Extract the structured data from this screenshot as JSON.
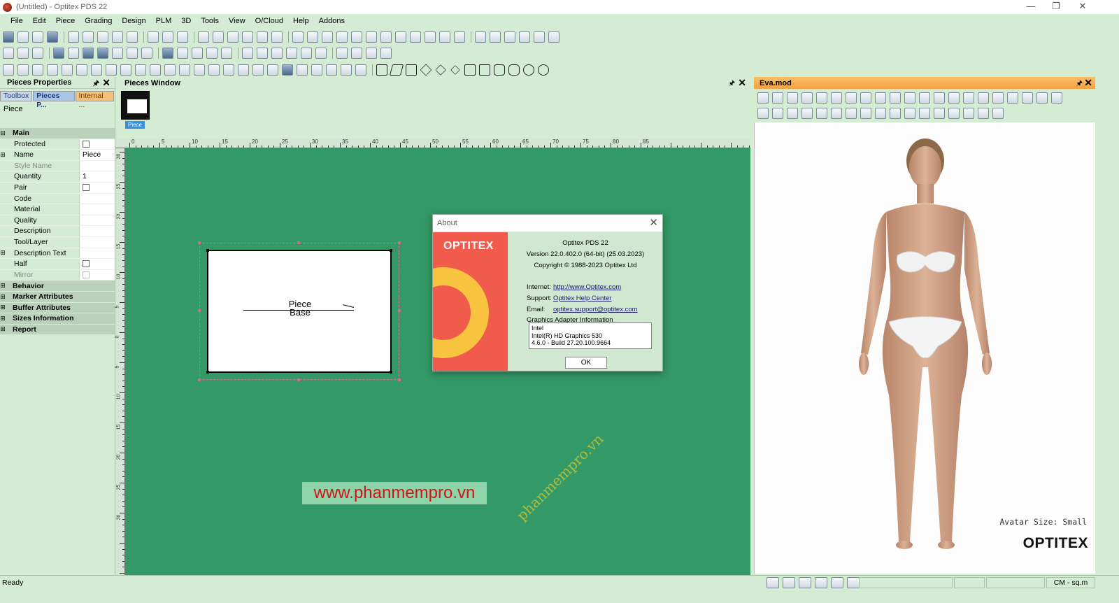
{
  "window": {
    "title": "(Untitled) - Optitex PDS 22"
  },
  "menu": [
    "File",
    "Edit",
    "Piece",
    "Grading",
    "Design",
    "PLM",
    "3D",
    "Tools",
    "View",
    "O/Cloud",
    "Help",
    "Addons"
  ],
  "left_panel": {
    "title": "Pieces Properties",
    "tabs": [
      "Toolbox",
      "Pieces P...",
      "Internal ..."
    ],
    "piece_label": "Piece",
    "main_section": "Main",
    "properties": [
      {
        "name": "Protected",
        "type": "checkbox",
        "value": ""
      },
      {
        "name": "Name",
        "type": "text",
        "value": "Piece",
        "expandable": true
      },
      {
        "name": "Style Name",
        "type": "text",
        "value": "",
        "disabled": true
      },
      {
        "name": "Quantity",
        "type": "text",
        "value": "1"
      },
      {
        "name": "Pair",
        "type": "checkbox",
        "value": ""
      },
      {
        "name": "Code",
        "type": "text",
        "value": ""
      },
      {
        "name": "Material",
        "type": "text",
        "value": ""
      },
      {
        "name": "Quality",
        "type": "text",
        "value": ""
      },
      {
        "name": "Description",
        "type": "text",
        "value": ""
      },
      {
        "name": "Tool/Layer",
        "type": "text",
        "value": ""
      },
      {
        "name": "Description Text",
        "type": "text",
        "value": "",
        "expandable": true
      },
      {
        "name": "Half",
        "type": "checkbox",
        "value": ""
      },
      {
        "name": "Mirror",
        "type": "checkbox",
        "value": "",
        "disabled": true
      }
    ],
    "sections": [
      "Behavior",
      "Marker Attributes",
      "Buffer Attributes",
      "Sizes Information",
      "Report"
    ]
  },
  "pieces_window": {
    "title": "Pieces Window",
    "thumbnail_label": "Piece",
    "ruler_top_labels": [
      "0",
      "5",
      "10",
      "15",
      "20",
      "25",
      "30",
      "35",
      "40",
      "45",
      "50",
      "55",
      "60",
      "65",
      "70",
      "75",
      "80",
      "85"
    ],
    "ruler_left_labels": [
      "30",
      "25",
      "20",
      "15",
      "10",
      "5",
      "0",
      "5",
      "10",
      "15",
      "20",
      "25",
      "30"
    ],
    "piece_text_line1": "Piece",
    "piece_text_line2": "Base",
    "watermark": "www.phanmempro.vn",
    "diagonal_watermark": "phanmempro.vn"
  },
  "about_dialog": {
    "title": "About",
    "brand": "OPTITEX",
    "product": "Optitex PDS 22",
    "version": "Version 22.0.402.0  (64-bit) (25.03.2023)",
    "copyright": "Copyright © 1988-2023 Optitex Ltd",
    "internet_label": "Internet:",
    "internet_link": "http://www.Optitex.com",
    "support_label": "Support:",
    "support_link": "Optitex Help Center",
    "email_label": "Email:",
    "email_link": "optitex.support@optitex.com",
    "gfx_title": "Graphics Adapter Information",
    "gfx_line1": "Intel",
    "gfx_line2": "Intel(R) HD Graphics 530",
    "gfx_line3": "4.6.0 - Build 27.20.100.9664",
    "ok_label": "OK"
  },
  "eva_panel": {
    "title": "Eva.mod",
    "avatar_size": "Avatar Size: Small",
    "logo": "OPTITEX"
  },
  "status": {
    "left": "Ready",
    "units": "CM - sq.m"
  },
  "colors": {
    "canvas_bg": "#339966",
    "panel_bg": "#d4ecd4",
    "eva_header": "#f5a142",
    "brand_red": "#f05b4c",
    "brand_yellow": "#f8c33e"
  }
}
